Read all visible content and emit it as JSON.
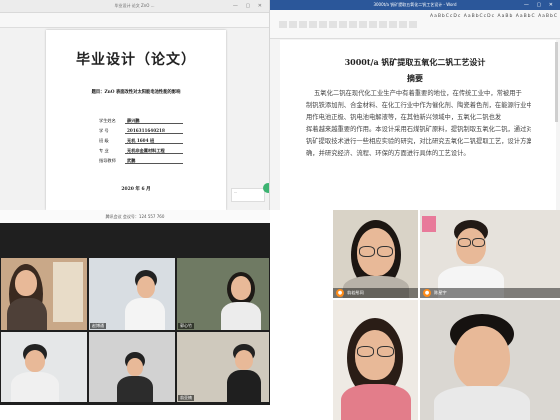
{
  "doc1": {
    "window_title": "毕业设计  论文  ZnO  ...",
    "title": "毕业设计（论文）",
    "subject_label": "题目：",
    "subject": "ZnO 表面改性对太阳能电池性能的影响",
    "info_rows": [
      {
        "label": "学生姓名",
        "value": "薛兴鹏"
      },
      {
        "label": "学    号",
        "value": "2016311640218"
      },
      {
        "label": "班    级",
        "value": "无机 1604 班"
      },
      {
        "label": "专    业",
        "value": "无机非金属材料工程"
      },
      {
        "label": "指导教师",
        "value": "武鹏"
      }
    ],
    "date": "2020 年 6 月",
    "chat_text": "..."
  },
  "doc2": {
    "window_title": "3000t/a 钒矿提取五氧化二钒工艺设计 - Word",
    "styles_row": "AaBbCcDc  AaBbCcDc  AaBb  AaBbC  AaBbC",
    "heading": "3000t/a 钒矿提取五氧化二钒工艺设计",
    "abstract_title": "摘要",
    "paragraph_lines": [
      "五氧化二钒在现代化工业生产中有着重要的地位，在传统工业中，常被用于",
      "制钒铁添加剂、合金材料、在化工行业中作为催化剂、陶瓷着色剂，在能源行业中，被",
      "用作电池正极、钒电池电解液等，在其他新兴领域中，五氧化二钒也发",
      "挥着越来越重要的作用。本设计采用石煤钒矿原料，提钒制取五氧化二钒，通过对",
      "钒矿提取技术进行一些相应实验的研究，对比研究五氧化二钒提取工艺，设计方案",
      "确，并研究经济、流程、环保的方面进行具体的工艺设计。"
    ]
  },
  "meeting": {
    "header": "腾讯会议 会议号：124 557 760",
    "participants": [
      "",
      "赵博通",
      "郭心竹",
      "",
      "",
      "翁亚楠"
    ]
  },
  "call": {
    "participants": [
      {
        "name": "翁若彤同"
      },
      {
        "name": "陈星宇"
      },
      {
        "name": ""
      },
      {
        "name": ""
      }
    ]
  },
  "colors": {
    "word_blue": "#2b579a",
    "mic_orange": "#ff8c1a",
    "chat_green": "#3cb371"
  }
}
